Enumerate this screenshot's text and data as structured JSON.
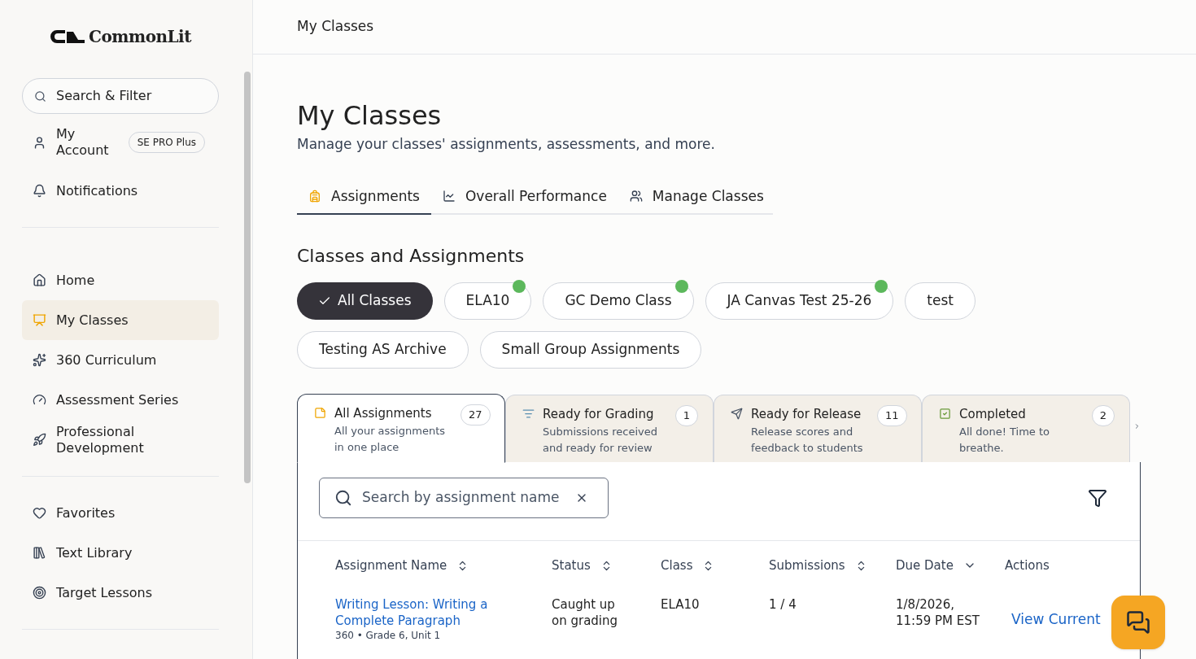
{
  "sidebar": {
    "logo": "CommonLit",
    "search": {
      "placeholder": "Search & Filter"
    },
    "account": {
      "label": "My Account",
      "badge": "SE PRO Plus"
    },
    "sections": [
      [
        {
          "label": "Notifications",
          "selected": false
        }
      ],
      [
        {
          "label": "Home",
          "selected": false
        },
        {
          "label": "My Classes",
          "selected": true
        },
        {
          "label": "360 Curriculum",
          "selected": false
        },
        {
          "label": "Assessment Series",
          "selected": false
        },
        {
          "label": "Professional Development",
          "selected": false
        }
      ],
      [
        {
          "label": "Favorites",
          "selected": false
        },
        {
          "label": "Text Library",
          "selected": false
        },
        {
          "label": "Target Lessons",
          "selected": false
        }
      ]
    ]
  },
  "header": {
    "title": "My Classes"
  },
  "page": {
    "title": "My Classes",
    "subtitle": "Manage your classes' assignments, assessments, and more."
  },
  "tabs": [
    {
      "label": "Assignments",
      "selected": true
    },
    {
      "label": "Overall Performance",
      "selected": false
    },
    {
      "label": "Manage Classes",
      "selected": false
    }
  ],
  "section_title": "Classes and Assignments",
  "class_filters": [
    {
      "label": "All Classes",
      "selected": true,
      "new": false
    },
    {
      "label": "ELA10",
      "selected": false,
      "new": true
    },
    {
      "label": "GC Demo Class",
      "selected": false,
      "new": true
    },
    {
      "label": "JA Canvas Test 25-26",
      "selected": false,
      "new": true
    },
    {
      "label": "test",
      "selected": false,
      "new": false
    },
    {
      "label": "Testing AS Archive",
      "selected": false,
      "new": false
    },
    {
      "label": "Small Group Assignments",
      "selected": false,
      "new": false
    }
  ],
  "assignment_tabs": [
    {
      "title": "All Assignments",
      "description": "All your assignments in one place",
      "count": "27",
      "selected": true
    },
    {
      "title": "Ready for Grading",
      "description": "Submissions received and ready for review",
      "count": "1",
      "selected": false
    },
    {
      "title": "Ready for Release",
      "description": "Release scores and feedback to students",
      "count": "11",
      "selected": false
    },
    {
      "title": "Completed",
      "description": "All done! Time to breathe.",
      "count": "2",
      "selected": false
    }
  ],
  "assignment_search": {
    "placeholder": "Search by assignment name"
  },
  "table": {
    "columns": [
      "Assignment Name",
      "Status",
      "Class",
      "Submissions",
      "Due Date",
      "Actions"
    ],
    "rows": [
      {
        "name": "Writing Lesson: Writing a Complete Paragraph",
        "meta": "360 • Grade 6, Unit 1",
        "status": "Caught up on grading",
        "class": "ELA10",
        "submissions": "1 / 4",
        "due": "1/8/2026, 11:59 PM EST",
        "action": "View Current"
      }
    ]
  }
}
